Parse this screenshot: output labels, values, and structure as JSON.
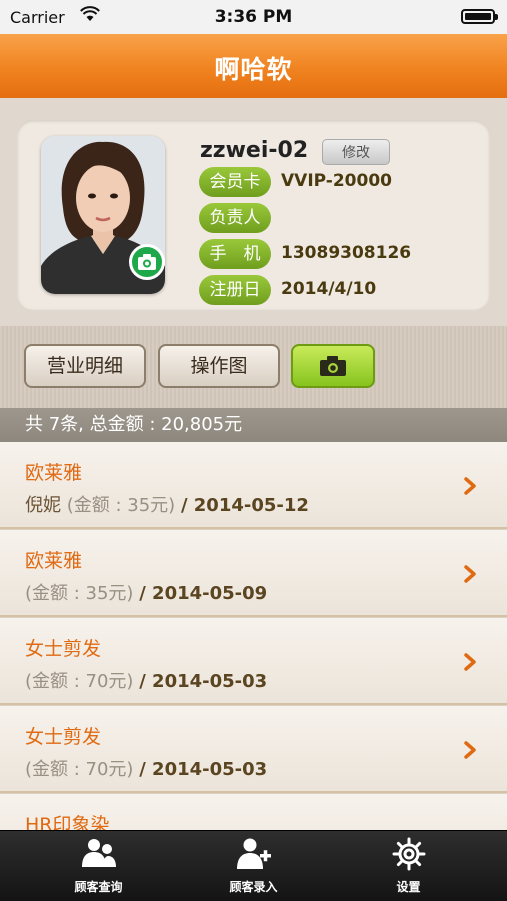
{
  "status_bar": {
    "carrier": "Carrier",
    "time": "3:36 PM"
  },
  "nav": {
    "title": "啊哈软"
  },
  "profile": {
    "username": "zzwei-02",
    "edit_label": "修改",
    "fields": [
      {
        "label": "会员卡",
        "value": "VVIP-20000"
      },
      {
        "label": "负责人",
        "value": ""
      },
      {
        "label": "手　机",
        "value": "13089308126"
      },
      {
        "label": "注册日",
        "value": "2014/4/10"
      }
    ]
  },
  "actions": {
    "business_details": "营业明细",
    "operation_photos": "操作图",
    "camera_icon": "camera-icon"
  },
  "summary": {
    "text": "共 7条, 总金额 : 20,805元"
  },
  "records": [
    {
      "service": "欧莱雅",
      "person": "倪妮",
      "amount": "(金额 : 35元)",
      "date": "/ 2014-05-12"
    },
    {
      "service": "欧莱雅",
      "person": "",
      "amount": "(金额 : 35元)",
      "date": "/ 2014-05-09"
    },
    {
      "service": "女士剪发",
      "person": "",
      "amount": "(金额 : 70元)",
      "date": "/ 2014-05-03"
    },
    {
      "service": "女士剪发",
      "person": "",
      "amount": "(金额 : 70元)",
      "date": "/ 2014-05-03"
    },
    {
      "service": "HR印象染",
      "person": "",
      "amount": "",
      "date": ""
    }
  ],
  "tabs": [
    {
      "label": "顾客查询",
      "icon": "customers-icon"
    },
    {
      "label": "顾客录入",
      "icon": "add-customer-icon"
    },
    {
      "label": "设置",
      "icon": "gear-icon"
    }
  ],
  "colors": {
    "accent": "#f08320",
    "green": "#86c41e",
    "orange_text": "#e06a12"
  }
}
